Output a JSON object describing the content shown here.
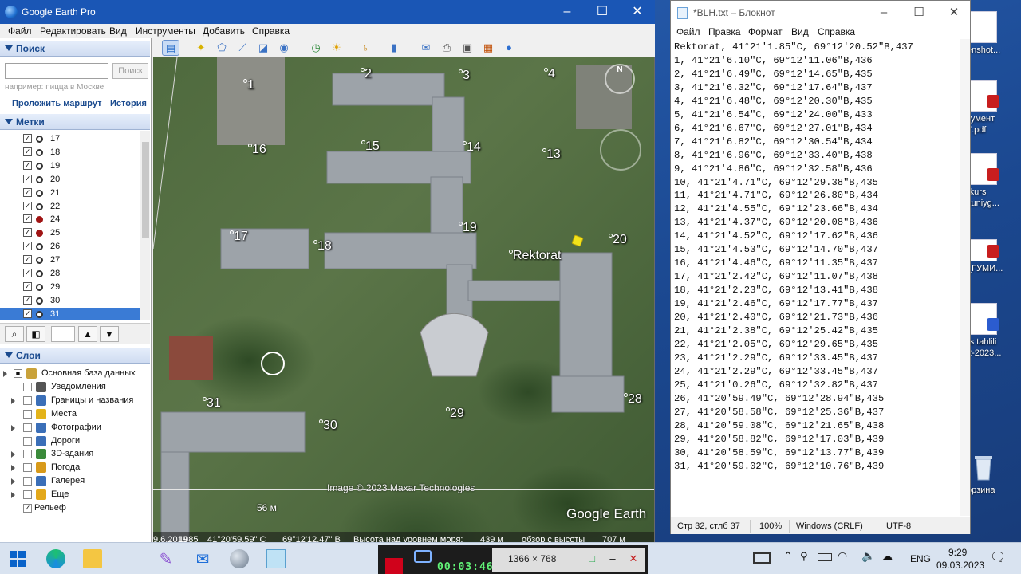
{
  "desktop": {
    "icons": [
      {
        "label": "enshot..."
      },
      {
        "label": "кумент\n7.pdf"
      },
      {
        "label": "-kurs\nkuniyg..."
      },
      {
        "label": "_ГУМИ..."
      },
      {
        "label": "rs tahlili\n2-2023..."
      },
      {
        "label": "орзина"
      }
    ]
  },
  "google_earth": {
    "title": "Google Earth Pro",
    "menu": [
      "Файл",
      "Редактировать",
      "Вид",
      "Инструменты",
      "Добавить",
      "Справка"
    ],
    "search": {
      "header": "Поиск",
      "placeholder": "",
      "button": "Поиск",
      "hint": "например: пицца в Москве",
      "route_link": "Проложить маршрут",
      "history_link": "История"
    },
    "places": {
      "header": "Метки",
      "items": [
        {
          "label": "17",
          "red": false
        },
        {
          "label": "18",
          "red": false
        },
        {
          "label": "19",
          "red": false
        },
        {
          "label": "20",
          "red": false
        },
        {
          "label": "21",
          "red": false
        },
        {
          "label": "22",
          "red": false
        },
        {
          "label": "24",
          "red": true
        },
        {
          "label": "25",
          "red": true
        },
        {
          "label": "26",
          "red": false
        },
        {
          "label": "27",
          "red": false
        },
        {
          "label": "28",
          "red": false
        },
        {
          "label": "29",
          "red": false
        },
        {
          "label": "30",
          "red": false
        },
        {
          "label": "31",
          "red": false,
          "selected": true
        }
      ]
    },
    "layers": {
      "header": "Слои",
      "items": [
        {
          "label": "Основная база данных"
        },
        {
          "label": "Уведомления"
        },
        {
          "label": "Границы и названия"
        },
        {
          "label": "Места"
        },
        {
          "label": "Фотографии"
        },
        {
          "label": "Дороги"
        },
        {
          "label": "3D-здания"
        },
        {
          "label": "Погода"
        },
        {
          "label": "Галерея"
        },
        {
          "label": "Еще"
        },
        {
          "label": "Рельеф"
        }
      ]
    },
    "map": {
      "labels": [
        "1",
        "2",
        "3",
        "4",
        "13",
        "14",
        "15",
        "16",
        "17",
        "18",
        "19",
        "20",
        "28",
        "29",
        "30",
        "31"
      ],
      "rektorat_label": "Rektorat",
      "compass_letter": "N",
      "attribution": "Image © 2023 Maxar Technologies",
      "brand": "Google Earth",
      "scale": "56 м"
    },
    "status": {
      "date": "9.6.2019",
      "year_overlay": "1985",
      "lat": "41°20'59.59\" С",
      "lon": "69°12'12.47\" В",
      "elevation_label": "Высота над уровнем моря:",
      "elevation": "439 м",
      "eye_alt_label": "обзор с высоты",
      "eye_alt": "707 м"
    }
  },
  "notepad": {
    "title": "*BLH.txt – Блокнот",
    "menu": [
      "Файл",
      "Правка",
      "Формат",
      "Вид",
      "Справка"
    ],
    "lines": [
      "Rektorat, 41°21'1.85\"С, 69°12'20.52\"В,437",
      "1, 41°21'6.10\"С, 69°12'11.06\"В,436",
      "2, 41°21'6.49\"С, 69°12'14.65\"В,435",
      "3, 41°21'6.32\"С, 69°12'17.64\"В,437",
      "4, 41°21'6.48\"С, 69°12'20.30\"В,435",
      "5, 41°21'6.54\"С, 69°12'24.00\"В,433",
      "6, 41°21'6.67\"С, 69°12'27.01\"В,434",
      "7, 41°21'6.82\"С, 69°12'30.54\"В,434",
      "8, 41°21'6.96\"С, 69°12'33.40\"В,438",
      "9, 41°21'4.86\"С, 69°12'32.58\"В,436",
      "10, 41°21'4.71\"С, 69°12'29.38\"В,435",
      "11, 41°21'4.71\"С, 69°12'26.80\"В,434",
      "12, 41°21'4.55\"С, 69°12'23.66\"В,434",
      "13, 41°21'4.37\"С, 69°12'20.08\"В,436",
      "14, 41°21'4.52\"С, 69°12'17.62\"В,436",
      "15, 41°21'4.53\"С, 69°12'14.70\"В,437",
      "16, 41°21'4.46\"С, 69°12'11.35\"В,437",
      "17, 41°21'2.42\"С, 69°12'11.07\"В,438",
      "18, 41°21'2.23\"С, 69°12'13.41\"В,438",
      "19, 41°21'2.46\"С, 69°12'17.77\"В,437",
      "20, 41°21'2.40\"С, 69°12'21.73\"В,436",
      "21, 41°21'2.38\"С, 69°12'25.42\"В,435",
      "22, 41°21'2.05\"С, 69°12'29.65\"В,435",
      "23, 41°21'2.29\"С, 69°12'33.45\"В,437",
      "24, 41°21'2.29\"С, 69°12'33.45\"В,437",
      "25, 41°21'0.26\"С, 69°12'32.82\"В,437",
      "26, 41°20'59.49\"С, 69°12'28.94\"В,435",
      "27, 41°20'58.58\"С, 69°12'25.36\"В,437",
      "28, 41°20'59.08\"С, 69°12'21.65\"В,438",
      "29, 41°20'58.82\"С, 69°12'17.03\"В,439",
      "30, 41°20'58.59\"С, 69°12'13.77\"В,439",
      "31, 41°20'59.02\"С, 69°12'10.76\"В,439"
    ],
    "status": {
      "cursor": "Стр 32, стлб 37",
      "zoom": "100%",
      "eol": "Windows (CRLF)",
      "encoding": "UTF-8"
    }
  },
  "recorder": {
    "timer": "00:03:46",
    "dimensions": "1366 × 768"
  },
  "taskbar": {
    "language": "ENG",
    "time": "9:29",
    "date": "09.03.2023"
  },
  "colors": {
    "ge_titlebar": "#1a56b5",
    "selection": "#3a7bd5",
    "red_pin": "#a01414",
    "pushpin": "#f2e21a",
    "timer_green": "#61f277",
    "record_red": "#d0021b"
  }
}
